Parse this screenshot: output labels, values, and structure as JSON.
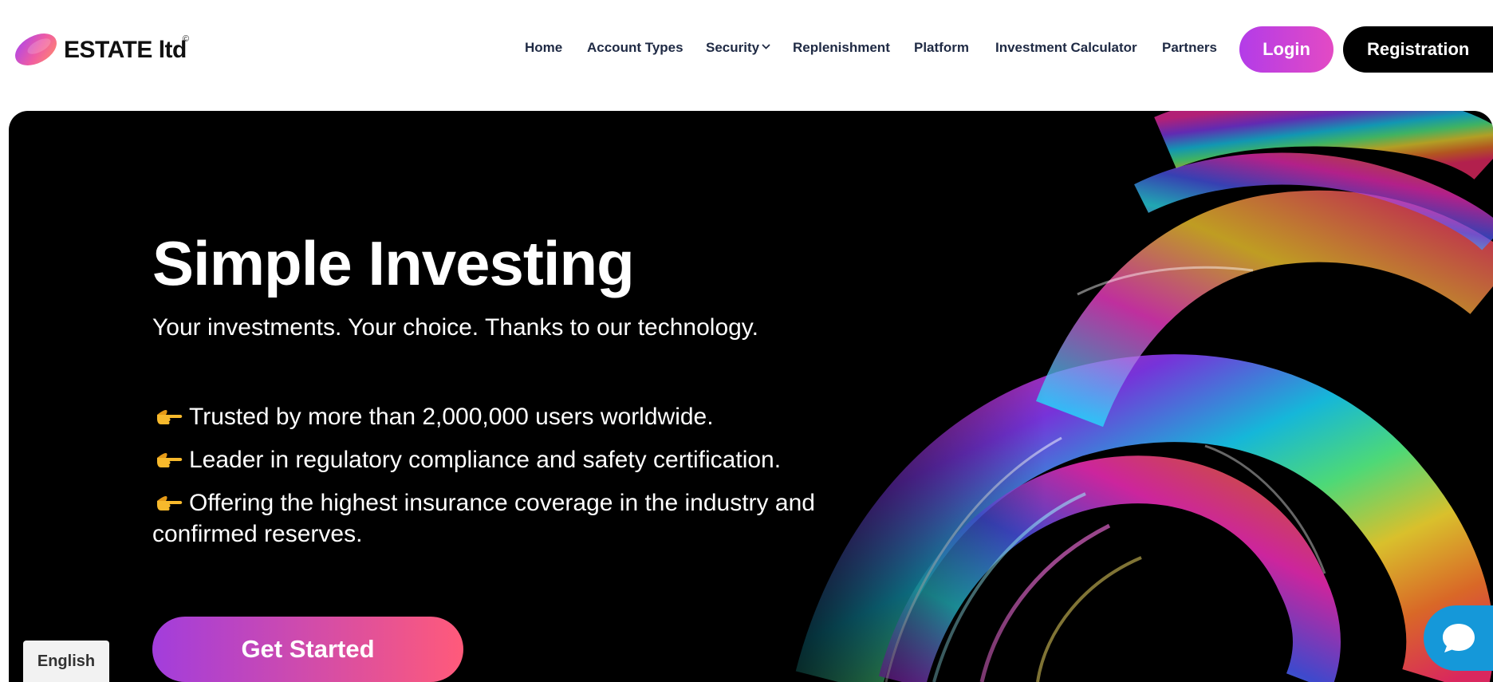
{
  "brand": {
    "name": "ESTATE ltd",
    "registered_mark": "©",
    "colors": {
      "accent": "#b33ce8",
      "accent_end": "#e34ac4"
    }
  },
  "nav": {
    "items": [
      {
        "label": "Home"
      },
      {
        "label": "Account Types"
      },
      {
        "label": "Security",
        "icon": "chevron-down-icon"
      },
      {
        "label": "Replenishment"
      },
      {
        "label": "Platform"
      },
      {
        "label": "Investment Calculator"
      },
      {
        "label": "Partners"
      }
    ],
    "login_label": "Login",
    "register_label": "Registration"
  },
  "hero": {
    "title": "Simple Investing",
    "subtitle": "Your investments. Your choice. Thanks to our technology.",
    "features": [
      "Trusted by more than 2,000,000 users worldwide.",
      "Leader in regulatory compliance and safety certification.",
      "Offering the highest insurance coverage in the industry and confirmed reserves."
    ],
    "feature_icon": "pointing-hand-icon",
    "cta_label": "Get Started"
  },
  "footer_widgets": {
    "language": "English",
    "chat_icon": "chat-bubble-icon"
  }
}
